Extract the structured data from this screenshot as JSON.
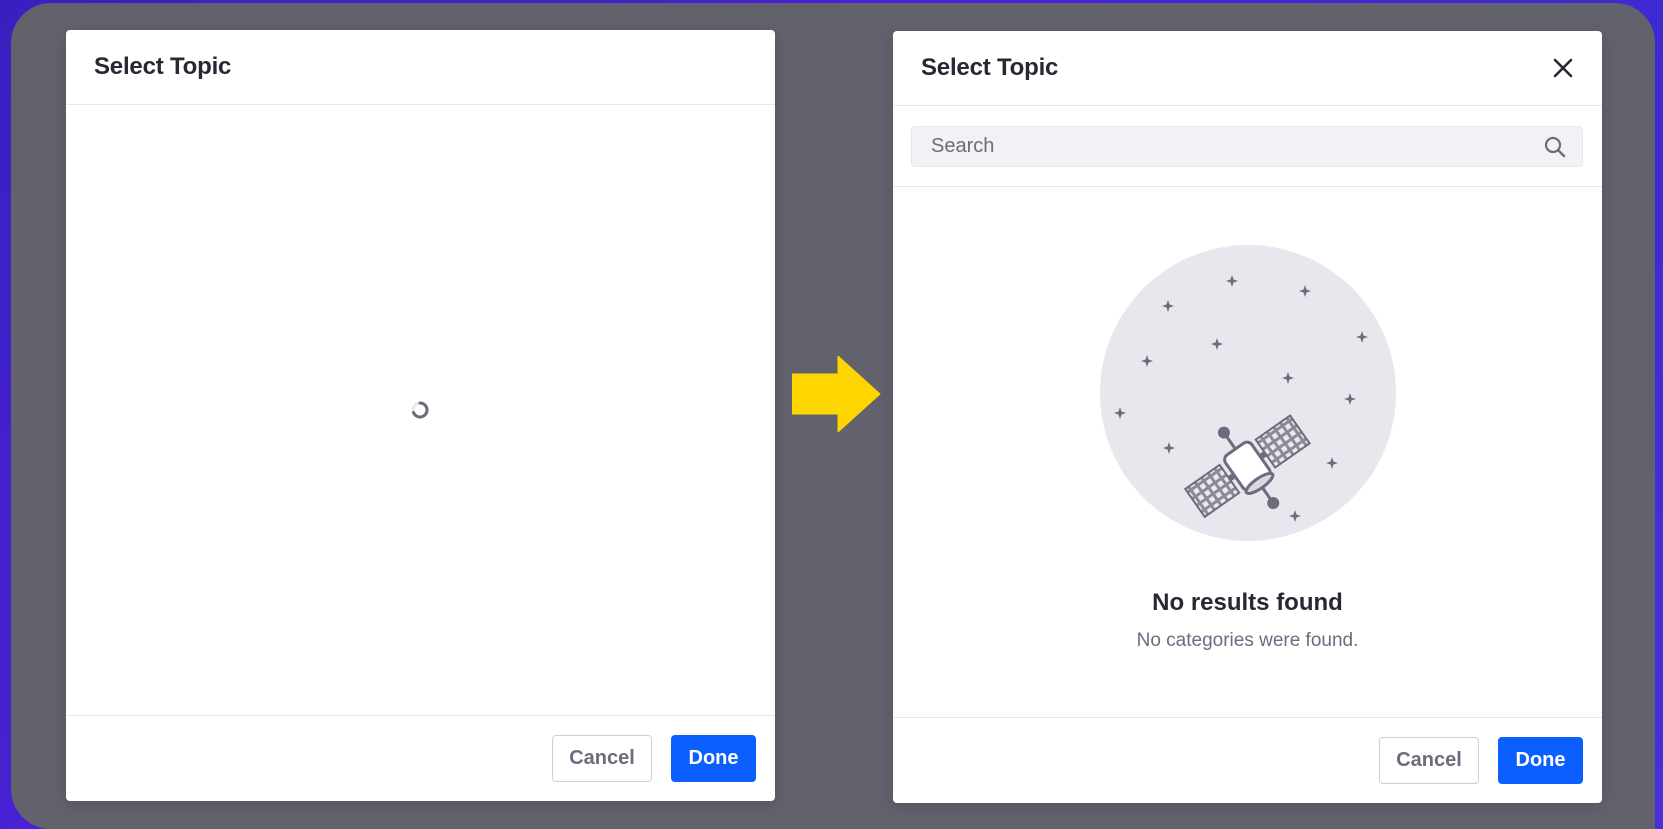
{
  "left_modal": {
    "title": "Select Topic",
    "cancel_label": "Cancel",
    "done_label": "Done",
    "state": "loading"
  },
  "right_modal": {
    "title": "Select Topic",
    "search": {
      "placeholder": "Search",
      "value": ""
    },
    "empty_state": {
      "title": "No results found",
      "description": "No categories were found."
    },
    "cancel_label": "Cancel",
    "done_label": "Done"
  },
  "colors": {
    "primary": "#0b5fff",
    "backdrop": "#62626d",
    "arrow": "#ffd500"
  },
  "icons": {
    "close": "close-icon",
    "search": "search-icon",
    "spinner": "loading-spinner-icon",
    "arrow": "arrow-right-icon",
    "empty": "satellite-illustration"
  }
}
